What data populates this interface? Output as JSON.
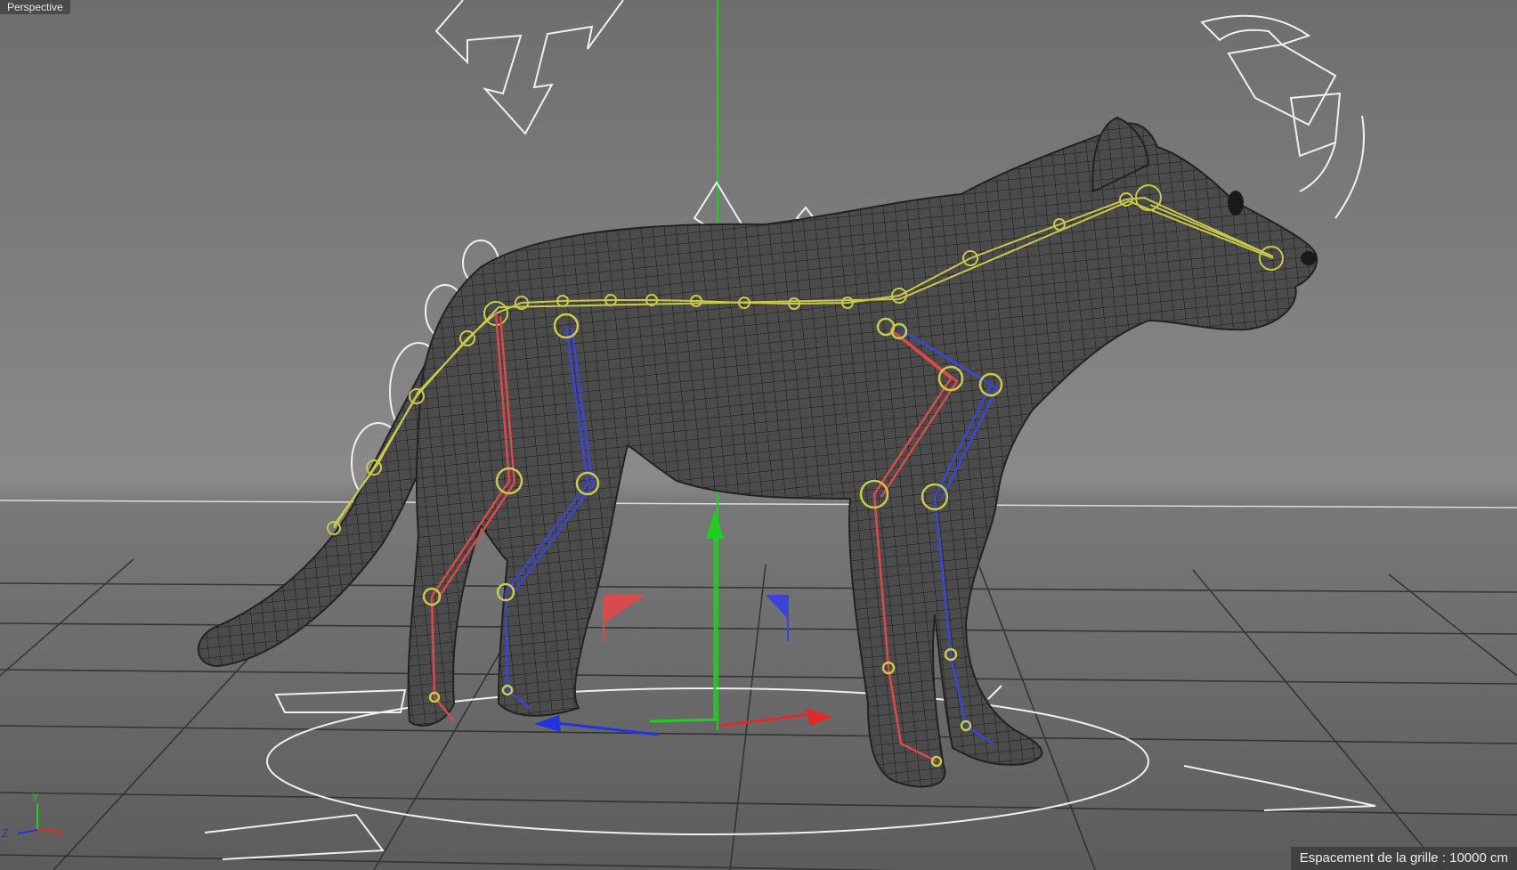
{
  "viewport": {
    "view_label": "Perspective",
    "grid_spacing": "Espacement de la grille : 10000 cm"
  },
  "axis_widget": {
    "y": "Y",
    "x": "X",
    "z": "Z"
  },
  "colors": {
    "background_top": "#6e6e6e",
    "floor": "#5c5c5c",
    "mesh_line": "#1a1a1a",
    "body": "#4a4a4a",
    "spine_joints": "#c9c94a",
    "left_legs": "#d94a4a",
    "right_legs": "#3c44d8",
    "handles": "#f0f0f0",
    "axis_y": "#22cc22",
    "axis_x": "#e02a2a",
    "axis_z": "#2233e0"
  },
  "icons": [
    "move-gizmo-icon",
    "rotate-gizmo-icon",
    "axis-gizmo-icon"
  ]
}
